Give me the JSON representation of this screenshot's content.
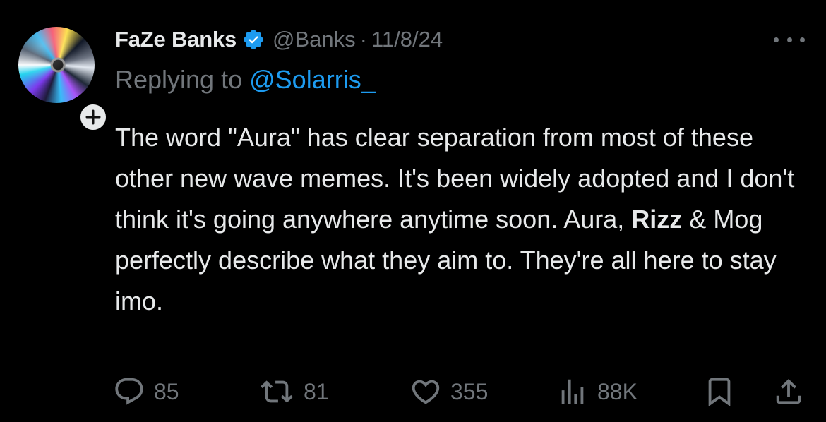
{
  "author": {
    "display_name": "FaZe Banks",
    "handle": "@Banks",
    "separator": "·",
    "date": "11/8/24",
    "verified": true,
    "avatar": "holographic-disc-avatar"
  },
  "reply": {
    "prefix": "Replying to",
    "mention": "@Solarris_"
  },
  "tweet": {
    "text_before_bold": "The word \"Aura\" has clear separation from most of these other new wave memes. It's been widely adopted and I don't think it's going anywhere anytime soon. Aura, ",
    "bold": "Rizz",
    "text_after_bold": " & Mog perfectly describe what they aim to. They're all here to stay imo."
  },
  "actions": {
    "replies": "85",
    "retweets": "81",
    "likes": "355",
    "views": "88K"
  },
  "icons": {
    "more": "more-dots-icon",
    "verified": "verified-badge-icon",
    "follow": "plus-icon",
    "reply": "reply-bubble-icon",
    "retweet": "retweet-icon",
    "like": "heart-icon",
    "views": "views-bars-icon",
    "bookmark": "bookmark-icon",
    "share": "share-icon"
  },
  "colors": {
    "background": "#000000",
    "text": "#e7e9ea",
    "muted": "#71767b",
    "accent": "#1d9bf0"
  }
}
